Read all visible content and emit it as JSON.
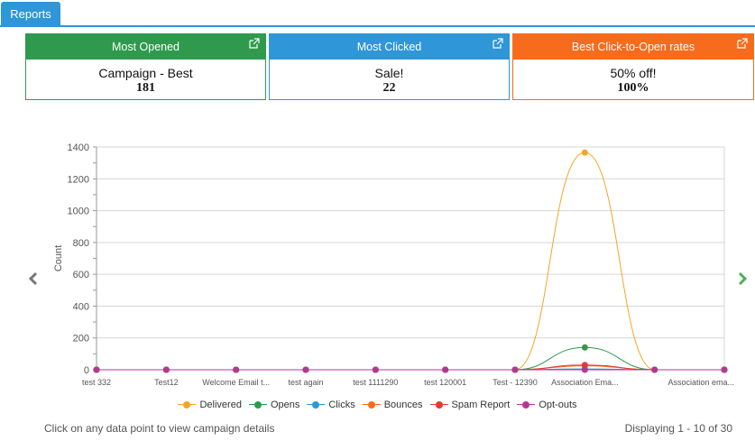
{
  "tabs": [
    {
      "label": "Reports"
    }
  ],
  "cards": [
    {
      "title": "Most Opened",
      "name": "Campaign - Best",
      "value": "181",
      "color": "#2f9a4d"
    },
    {
      "title": "Most Clicked",
      "name": "Sale!",
      "value": "22",
      "color": "#2f96d7"
    },
    {
      "title": "Best Click-to-Open rates",
      "name": "50% off!",
      "value": "100%",
      "color": "#f76b1c"
    }
  ],
  "chart_data": {
    "type": "line",
    "ylabel": "Count",
    "ylim": [
      0,
      1400
    ],
    "yticks": [
      0,
      200,
      400,
      600,
      800,
      1000,
      1200,
      1400
    ],
    "categories": [
      "test 332",
      "Test12",
      "Welcome Email t...",
      "test again",
      "test 1111290",
      "test 120001",
      "Test - 12390",
      "Association Ema...",
      "",
      "Association ema..."
    ],
    "grid": true,
    "legend_position": "bottom",
    "series": [
      {
        "name": "Delivered",
        "color": "#f5a623",
        "values": [
          0,
          0,
          0,
          0,
          0,
          0,
          0,
          1365,
          0,
          0
        ]
      },
      {
        "name": "Opens",
        "color": "#2f9a4d",
        "values": [
          0,
          0,
          0,
          0,
          0,
          0,
          0,
          140,
          0,
          0
        ]
      },
      {
        "name": "Clicks",
        "color": "#2f96d7",
        "values": [
          0,
          0,
          0,
          0,
          0,
          0,
          0,
          5,
          0,
          0
        ]
      },
      {
        "name": "Bounces",
        "color": "#f76b1c",
        "values": [
          0,
          0,
          0,
          0,
          0,
          0,
          0,
          25,
          0,
          0
        ]
      },
      {
        "name": "Spam Report",
        "color": "#e03a3a",
        "values": [
          0,
          0,
          0,
          0,
          0,
          0,
          0,
          30,
          0,
          0
        ]
      },
      {
        "name": "Opt-outs",
        "color": "#b03a8f",
        "values": [
          0,
          0,
          0,
          0,
          0,
          0,
          0,
          0,
          0,
          0
        ]
      }
    ]
  },
  "footer": {
    "hint": "Click on any data point to view campaign details",
    "paging": "Displaying 1 - 10 of 30"
  }
}
